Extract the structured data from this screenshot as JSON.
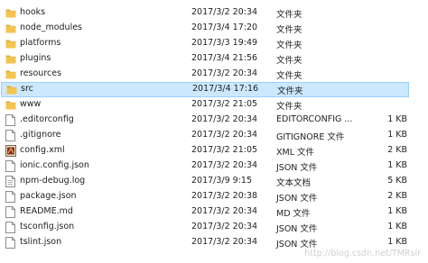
{
  "files": [
    {
      "name": "hooks",
      "date": "2017/3/2 20:34",
      "type": "文件夹",
      "size": "",
      "icon": "folder-icon",
      "selected": false
    },
    {
      "name": "node_modules",
      "date": "2017/3/4 17:20",
      "type": "文件夹",
      "size": "",
      "icon": "folder-icon",
      "selected": false
    },
    {
      "name": "platforms",
      "date": "2017/3/3 19:49",
      "type": "文件夹",
      "size": "",
      "icon": "folder-icon",
      "selected": false
    },
    {
      "name": "plugins",
      "date": "2017/3/4 21:56",
      "type": "文件夹",
      "size": "",
      "icon": "folder-icon",
      "selected": false
    },
    {
      "name": "resources",
      "date": "2017/3/2 20:34",
      "type": "文件夹",
      "size": "",
      "icon": "folder-icon",
      "selected": false
    },
    {
      "name": "src",
      "date": "2017/3/4 17:16",
      "type": "文件夹",
      "size": "",
      "icon": "folder-icon",
      "selected": true
    },
    {
      "name": "www",
      "date": "2017/3/2 21:05",
      "type": "文件夹",
      "size": "",
      "icon": "folder-icon",
      "selected": false
    },
    {
      "name": ".editorconfig",
      "date": "2017/3/2 20:34",
      "type": "EDITORCONFIG ...",
      "size": "1 KB",
      "icon": "file-icon",
      "selected": false
    },
    {
      "name": ".gitignore",
      "date": "2017/3/2 20:34",
      "type": "GITIGNORE 文件",
      "size": "1 KB",
      "icon": "file-icon",
      "selected": false
    },
    {
      "name": "config.xml",
      "date": "2017/3/2 21:05",
      "type": "XML 文件",
      "size": "2 KB",
      "icon": "xml-file-icon",
      "selected": false
    },
    {
      "name": "ionic.config.json",
      "date": "2017/3/2 20:34",
      "type": "JSON 文件",
      "size": "1 KB",
      "icon": "file-icon",
      "selected": false
    },
    {
      "name": "npm-debug.log",
      "date": "2017/3/9 9:15",
      "type": "文本文档",
      "size": "5 KB",
      "icon": "text-file-icon",
      "selected": false
    },
    {
      "name": "package.json",
      "date": "2017/3/2 20:38",
      "type": "JSON 文件",
      "size": "2 KB",
      "icon": "file-icon",
      "selected": false
    },
    {
      "name": "README.md",
      "date": "2017/3/2 20:34",
      "type": "MD 文件",
      "size": "1 KB",
      "icon": "file-icon",
      "selected": false
    },
    {
      "name": "tsconfig.json",
      "date": "2017/3/2 20:34",
      "type": "JSON 文件",
      "size": "1 KB",
      "icon": "file-icon",
      "selected": false
    },
    {
      "name": "tslint.json",
      "date": "2017/3/2 20:34",
      "type": "JSON 文件",
      "size": "1 KB",
      "icon": "file-icon",
      "selected": false
    }
  ],
  "watermark": "http://blog.csdn.net/TMRsir",
  "colors": {
    "folder": "#f0c24b",
    "folder_dark": "#dca83a",
    "selection_bg": "#cce8ff",
    "selection_border": "#99d1ff"
  }
}
